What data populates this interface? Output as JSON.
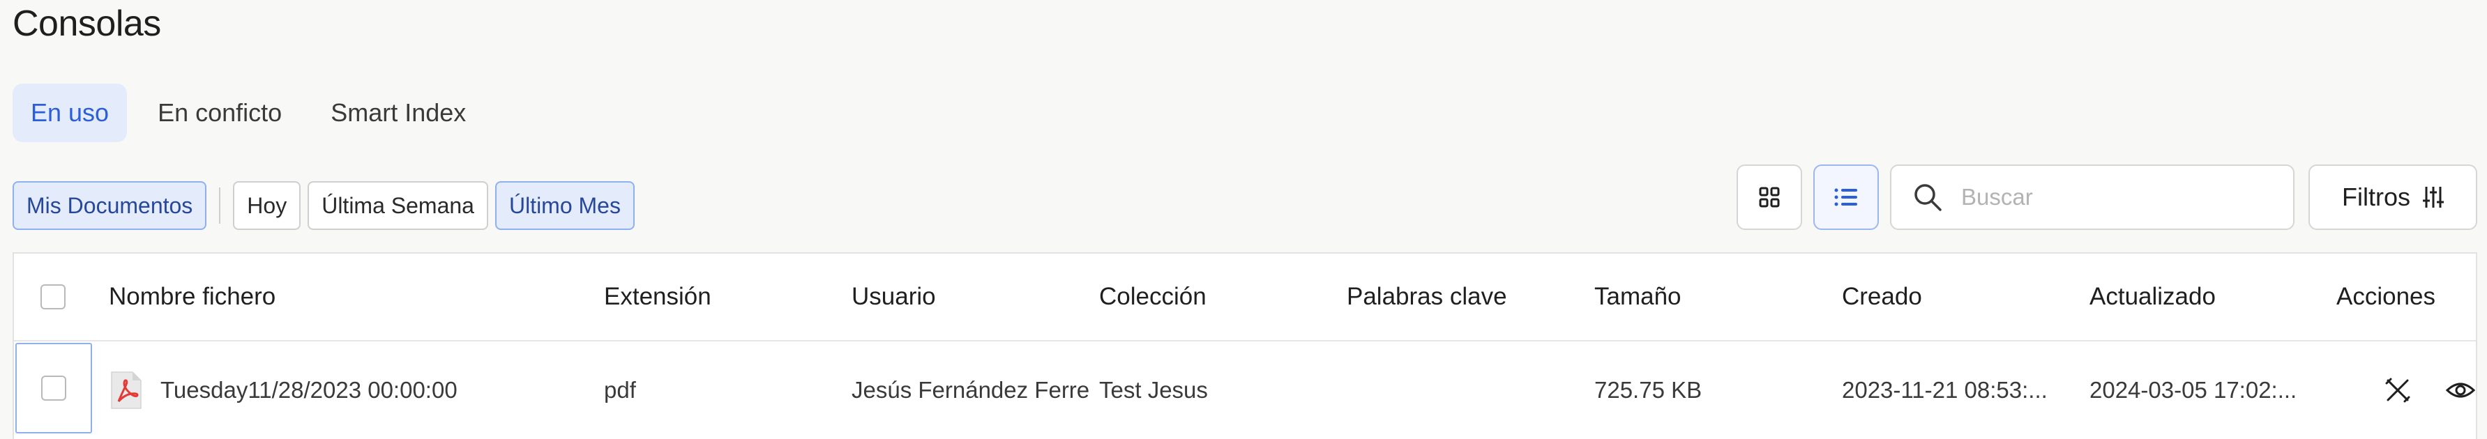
{
  "page": {
    "title": "Consolas"
  },
  "tabs": [
    {
      "label": "En uso",
      "active": true
    },
    {
      "label": "En conficto",
      "active": false
    },
    {
      "label": "Smart Index",
      "active": false
    }
  ],
  "chips": {
    "mine": "Mis Documentos",
    "today": "Hoy",
    "week": "Última Semana",
    "month": "Último Mes"
  },
  "toolbar": {
    "search_placeholder": "Buscar",
    "filters_label": "Filtros",
    "view_mode": "list"
  },
  "table": {
    "columns": {
      "name": "Nombre fichero",
      "ext": "Extensión",
      "user": "Usuario",
      "collection": "Colección",
      "keywords": "Palabras clave",
      "size": "Tamaño",
      "created": "Creado",
      "updated": "Actualizado",
      "actions": "Acciones"
    },
    "rows": [
      {
        "name": "Tuesday11/28/2023 00:00:00",
        "ext": "pdf",
        "user": "Jesús Fernández Ferre",
        "collection": "Test Jesus",
        "keywords": "",
        "size": "725.75 KB",
        "created": "2023-11-21 08:53:...",
        "updated": "2024-03-05 17:02:...",
        "file_icon": "pdf-icon"
      }
    ]
  },
  "colors": {
    "accent": "#2b5fd9",
    "accent_bg": "#e4ecfb",
    "pdf_red": "#e53935"
  }
}
